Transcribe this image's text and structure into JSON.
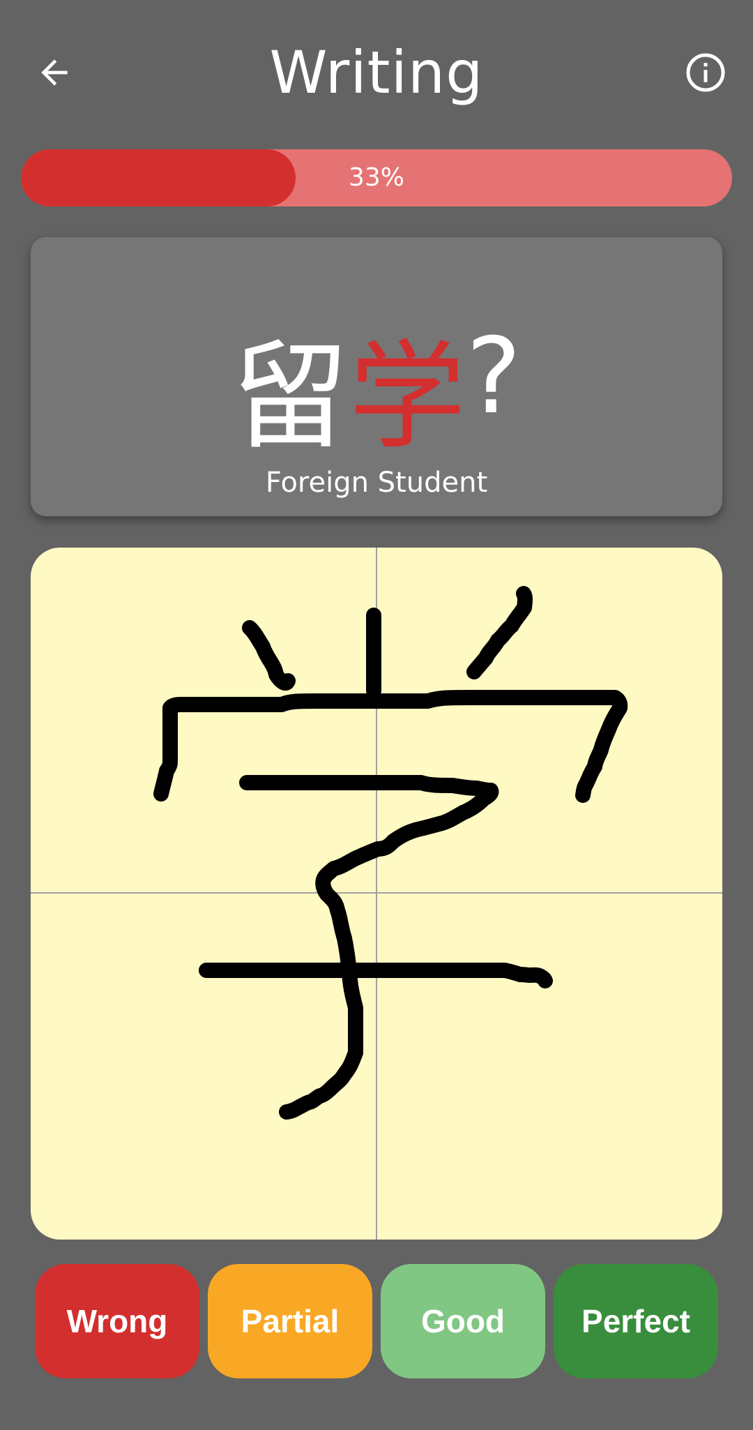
{
  "header": {
    "title": "Writing",
    "back_icon": "arrow-left-icon",
    "info_icon": "info-circle-icon"
  },
  "progress": {
    "percent": 33,
    "label": "33%",
    "fill_color": "#d32f2f",
    "track_color": "#e57373"
  },
  "prompt": {
    "known_char": "留",
    "target_char": "学",
    "question_mark": "?",
    "meaning": "Foreign Student",
    "highlight_color": "#d32f2f"
  },
  "writing_pad": {
    "background": "#fff9c4"
  },
  "ratings": [
    {
      "label": "Wrong",
      "color": "#d32f2f"
    },
    {
      "label": "Partial",
      "color": "#f9a825"
    },
    {
      "label": "Good",
      "color": "#81c784"
    },
    {
      "label": "Perfect",
      "color": "#388e3c"
    }
  ]
}
